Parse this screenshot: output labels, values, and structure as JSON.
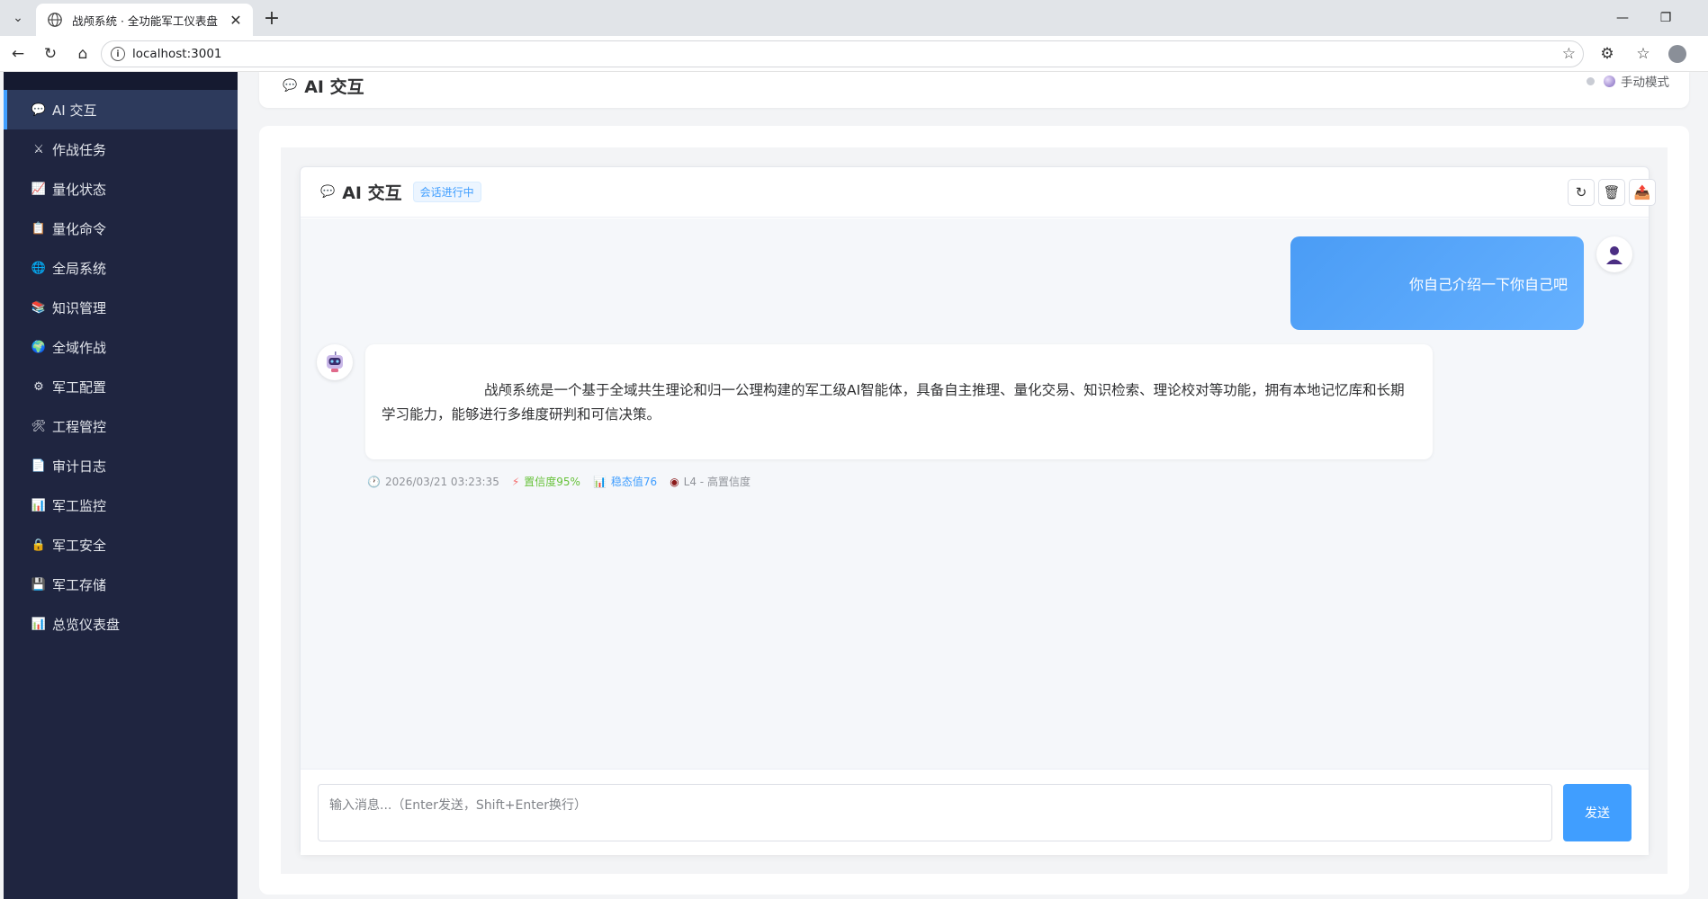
{
  "browser": {
    "tab_title": "战颅系统 · 全功能军工仪表盘",
    "url": "localhost:3001"
  },
  "sidebar": {
    "items": [
      {
        "label": "AI 交互",
        "icon": "speech-bubble-icon",
        "active": true
      },
      {
        "label": "作战任务",
        "icon": "crossed-swords-icon"
      },
      {
        "label": "量化状态",
        "icon": "line-chart-icon"
      },
      {
        "label": "量化命令",
        "icon": "clipboard-icon"
      },
      {
        "label": "全局系统",
        "icon": "globe-icon"
      },
      {
        "label": "知识管理",
        "icon": "books-icon"
      },
      {
        "label": "全域作战",
        "icon": "earth-icon"
      },
      {
        "label": "军工配置",
        "icon": "gear-icon"
      },
      {
        "label": "工程管控",
        "icon": "tools-icon"
      },
      {
        "label": "审计日志",
        "icon": "document-icon"
      },
      {
        "label": "军工监控",
        "icon": "bar-chart-icon"
      },
      {
        "label": "军工安全",
        "icon": "lock-icon"
      },
      {
        "label": "军工存储",
        "icon": "floppy-disk-icon"
      },
      {
        "label": "总览仪表盘",
        "icon": "bar-chart-icon"
      }
    ]
  },
  "header": {
    "title": "AI 交互",
    "mode_label": "手动模式"
  },
  "chat": {
    "title": "AI 交互",
    "status_badge": "会话进行中",
    "user_message": "你自己介绍一下你自己吧",
    "bot_message": "战颅系统是一个基于全域共生理论和归一公理构建的军工级AI智能体，具备自主推理、量化交易、知识检索、理论校对等功能，拥有本地记忆库和长期学习能力，能够进行多维度研判和可信决策。",
    "meta": {
      "timestamp": "2026/03/21 03:23:35",
      "confidence": "置信度95%",
      "stability": "稳态值76",
      "level": "L4 - 高置信度"
    },
    "input_placeholder": "输入消息...（Enter发送，Shift+Enter换行）",
    "send_label": "发送"
  },
  "colors": {
    "sidebar_bg": "#1f2540",
    "sidebar_active": "#2d3a5c",
    "accent": "#409eff",
    "confidence_green": "#67c23a"
  }
}
